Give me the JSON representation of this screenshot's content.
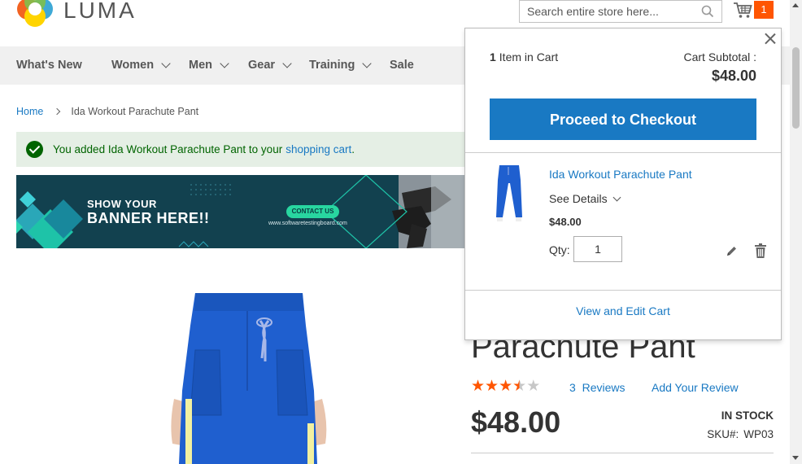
{
  "header": {
    "logo_text": "LUMA",
    "search_placeholder": "Search entire store here...",
    "cart_count": "1"
  },
  "nav": {
    "items": [
      {
        "label": "What's New"
      },
      {
        "label": "Women"
      },
      {
        "label": "Men"
      },
      {
        "label": "Gear"
      },
      {
        "label": "Training"
      },
      {
        "label": "Sale"
      }
    ]
  },
  "breadcrumb": {
    "home": "Home",
    "current": "Ida Workout Parachute Pant"
  },
  "message": {
    "text": "You added Ida Workout Parachute Pant to your",
    "link": "shopping cart",
    "end": "."
  },
  "banner": {
    "line1": "SHOW YOUR",
    "line2": "BANNER HERE!!",
    "contact": "CONTACT US",
    "url": "www.softwaretestingboard.com"
  },
  "product": {
    "title": "Parachute Pant",
    "rating": 3.5,
    "rating_max": 5,
    "reviews_count": "3",
    "reviews_label": "Reviews",
    "add_review": "Add Your Review",
    "price": "$48.00",
    "stock": "IN STOCK",
    "sku_label": "SKU#:",
    "sku": "WP03"
  },
  "minicart": {
    "count": "1",
    "count_label": "Item in Cart",
    "subtotal_label": "Cart Subtotal :",
    "subtotal": "$48.00",
    "checkout": "Proceed to Checkout",
    "item": {
      "name": "Ida Workout Parachute Pant",
      "details": "See Details",
      "price": "$48.00",
      "qty_label": "Qty:",
      "qty": "1"
    },
    "view_edit": "View and Edit Cart"
  },
  "colors": {
    "accent": "#1979c3",
    "badge": "#ff5501",
    "star": "#ff5501",
    "success": "#006400"
  }
}
